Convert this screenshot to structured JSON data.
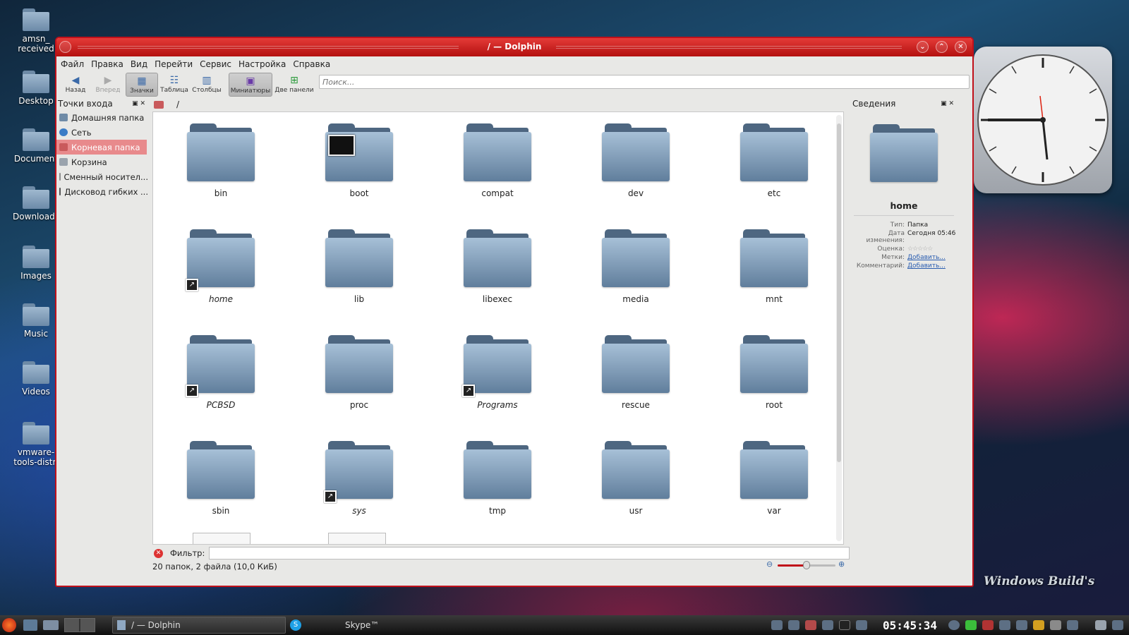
{
  "desktop": {
    "icons": [
      "amsn_\nreceived",
      "Desktop",
      "Document",
      "Downloads",
      "Images",
      "Music",
      "Videos",
      "vmware-\ntools-distri"
    ],
    "brand": "Windows Build's"
  },
  "window": {
    "title": "/ — Dolphin",
    "menu": [
      "Файл",
      "Правка",
      "Вид",
      "Перейти",
      "Сервис",
      "Настройка",
      "Справка"
    ],
    "toolbar": {
      "back": "Назад",
      "forward": "Вперед",
      "icons": "Значки",
      "table": "Таблица",
      "columns": "Столбцы",
      "thumbnails": "Миниатюры",
      "split": "Две панели"
    },
    "search_placeholder": "Поиск...",
    "location": "/",
    "places": {
      "title": "Точки входа",
      "items": [
        "Домашняя папка",
        "Сеть",
        "Корневая папка",
        "Корзина",
        "Сменный носител...",
        "Дисковод гибких ..."
      ]
    },
    "files": [
      {
        "name": "bin"
      },
      {
        "name": "boot"
      },
      {
        "name": "compat"
      },
      {
        "name": "dev"
      },
      {
        "name": "etc"
      },
      {
        "name": "home"
      },
      {
        "name": "lib"
      },
      {
        "name": "libexec"
      },
      {
        "name": "media"
      },
      {
        "name": "mnt"
      },
      {
        "name": "PCBSD"
      },
      {
        "name": "proc"
      },
      {
        "name": "Programs"
      },
      {
        "name": "rescue"
      },
      {
        "name": "root"
      },
      {
        "name": "sbin"
      },
      {
        "name": "sys"
      },
      {
        "name": "tmp"
      },
      {
        "name": "usr"
      },
      {
        "name": "var"
      }
    ],
    "filter_label": "Фильтр:",
    "status": "20 папок, 2 файла (10,0 КиБ)",
    "info": {
      "title": "Сведения",
      "name": "home",
      "type_label": "Тип:",
      "type_value": "Папка",
      "modified_label": "Дата\nизменения:",
      "modified_value": "Сегодня 05:46",
      "rating_label": "Оценка:",
      "rating_value": "☆☆☆☆☆",
      "tags_label": "Метки:",
      "tags_value": "Добавить...",
      "comment_label": "Комментарий:",
      "comment_value": "Добавить..."
    }
  },
  "taskbar": {
    "task_dolphin": "/ — Dolphin",
    "task_skype": "Skype™",
    "time": "05:45:34"
  }
}
